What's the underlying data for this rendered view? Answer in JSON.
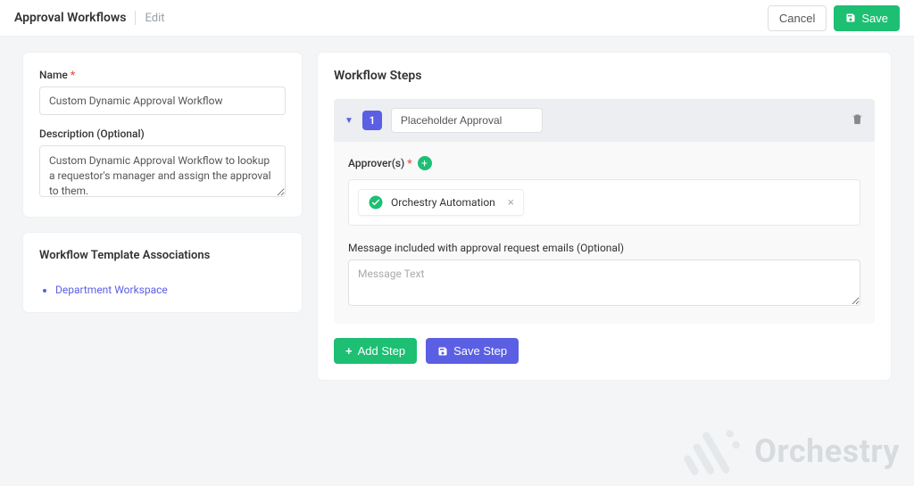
{
  "header": {
    "title": "Approval Workflows",
    "subtitle": "Edit",
    "cancel": "Cancel",
    "save": "Save"
  },
  "form": {
    "name_label": "Name",
    "name_value": "Custom Dynamic Approval Workflow",
    "desc_label": "Description (Optional)",
    "desc_value": "Custom Dynamic Approval Workflow to lookup a requestor's manager and assign the approval to them."
  },
  "associations": {
    "heading": "Workflow Template Associations",
    "items": [
      "Department Workspace"
    ]
  },
  "steps": {
    "heading": "Workflow Steps",
    "step1": {
      "number": "1",
      "name": "Placeholder Approval",
      "approvers_label": "Approver(s)",
      "approver_chip": "Orchestry Automation",
      "message_label": "Message included with approval request emails (Optional)",
      "message_placeholder": "Message Text"
    },
    "add_step": "Add Step",
    "save_step": "Save Step"
  },
  "brand": "Orchestry"
}
